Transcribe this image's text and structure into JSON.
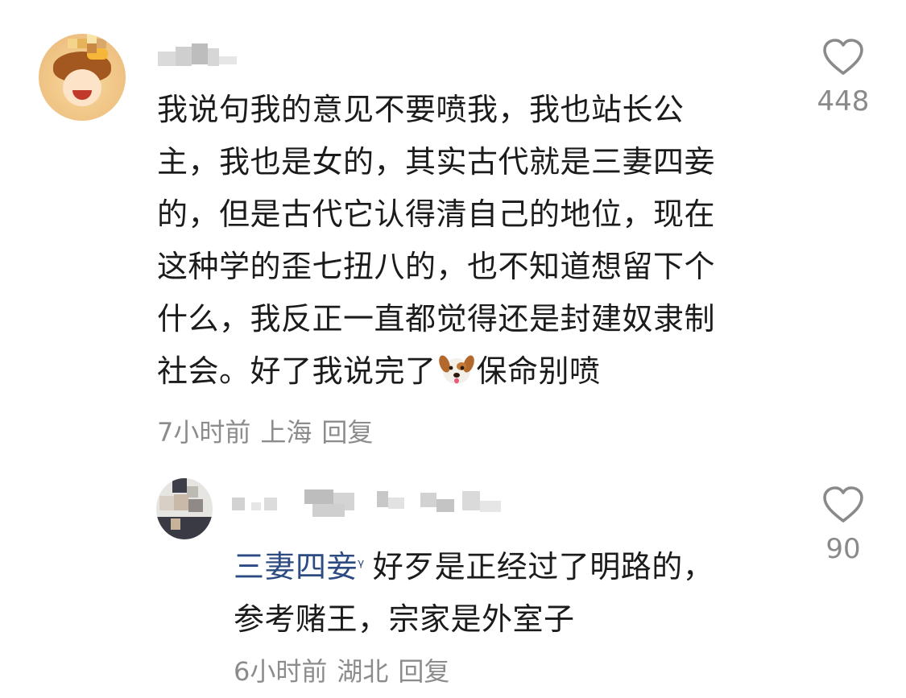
{
  "comments": [
    {
      "text_lines": [
        "我说句我的意见不要喷我，我也站长公",
        "主，我也是女的，其实古代就是三妻四妾",
        "的，但是古代它认得清自己的地位，现在",
        "这种学的歪七扭八的，也不知道想留下个",
        "什么，我反正一直都觉得还是封建奴隶制",
        "社会。好了我说完了"
      ],
      "emoji": "dog-face-emoji",
      "text_tail": "保命别喷",
      "time": "7小时前",
      "location": "上海",
      "reply_label": "回复",
      "like_count": "448"
    },
    {
      "mention": "三妻四妾",
      "mention_icon": "search-icon",
      "text_first": "好歹是正经过了明路的，",
      "text_second": "参考赌王，宗家是外室子",
      "time": "6小时前",
      "location": "湖北",
      "reply_label": "回复",
      "like_count": "90"
    }
  ],
  "colors": {
    "text": "#1b1b1b",
    "meta": "#8c8c8c",
    "mention": "#2c4b82",
    "like_icon": "#8a8a8a"
  }
}
